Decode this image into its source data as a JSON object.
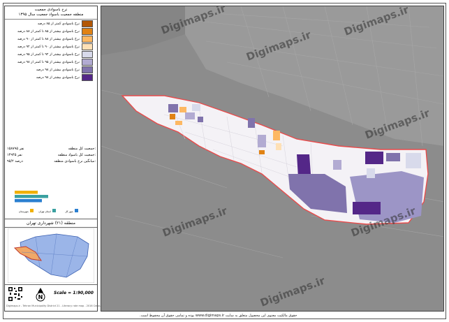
{
  "legend": {
    "title_line1": "نرخ باسوادی جمعیت",
    "title_line2": "منطقه جمعیت باسواد جمعیت سال ۱۳۹۵",
    "items": [
      {
        "label": "نرخ باسوادی کمتر از ۸۵ درصد",
        "color": "#b35806"
      },
      {
        "label": "نرخ باسوادی بیشتر از ۸۵ تا کمتر از ۸۸ درصد",
        "color": "#e08214"
      },
      {
        "label": "نرخ باسوادی بیشتر از ۸۸ تا کمتر از ۹۰ درصد",
        "color": "#fdb863"
      },
      {
        "label": "نرخ باسوادی بیشتر از ۹۰ تا کمتر از ۹۲ درصد",
        "color": "#fee0b6"
      },
      {
        "label": "نرخ باسوادی بیشتر از ۹۲ تا کمتر از ۹۵ درصد",
        "color": "#d8daeb"
      },
      {
        "label": "نرخ باسوادی بیشتر از ۹۵ تا کمتر از ۹۸ درصد",
        "color": "#b2abd2"
      },
      {
        "label": "نرخ باسوادی بیشتر از ۹۸ درصد",
        "color": "#8073ac"
      },
      {
        "label": "نرخ باسوادی بیشتر از ۹۸ درصد",
        "color": "#542788"
      }
    ]
  },
  "stats": {
    "total_label": "جمعیت کل منطقه:",
    "total_value": "۱۵۸۷۹۵ نفر",
    "literate_label": "جمعیت کل باسواد منطقه:",
    "literate_value": "۱۴۹۴۵ نفر",
    "rate_label": "میانگین نرخ باسوادی منطقه:",
    "rate_value": "۹۵/۲ درصد"
  },
  "chart_data": {
    "type": "bar",
    "categories": [
      "",
      "",
      ""
    ],
    "values": [
      55,
      80,
      65
    ],
    "colors": [
      "#f0b000",
      "#3aa0a0",
      "#2a7fd0"
    ],
    "legend": [
      "شهرستان",
      "استان تهران",
      "شهر کل"
    ]
  },
  "inset": {
    "title": "منطقه (۲۱) شهرداری تهران"
  },
  "bottom": {
    "scale": "Scale = 1:90,000",
    "north": "N",
    "footer": "Digimaps.ir - Tehran Municipality District 21 - Literacy rate map - 2016 Census"
  },
  "watermark": "Digimaps.ir",
  "credit": "حقوق مالکیت معنوی این محصول متعلق به سایت www.digimaps.ir بوده و تمامی حقوق آن محفوظ است.",
  "colors": {
    "boundary": "#e84b4b",
    "district_fill": "#f4f2f7",
    "map_bg": "#8a8a8a"
  }
}
